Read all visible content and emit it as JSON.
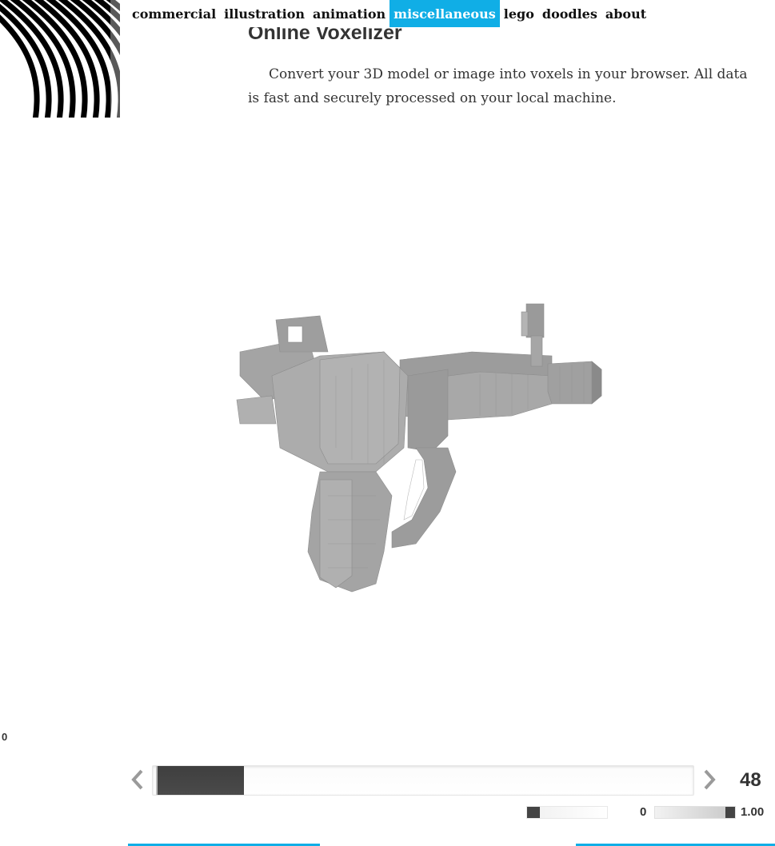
{
  "nav": {
    "items": [
      {
        "label": "commercial",
        "active": false
      },
      {
        "label": "illustration",
        "active": false
      },
      {
        "label": "animation",
        "active": false
      },
      {
        "label": "miscellaneous",
        "active": true
      },
      {
        "label": "lego",
        "active": false
      },
      {
        "label": "doodles",
        "active": false
      },
      {
        "label": "about",
        "active": false
      }
    ]
  },
  "page": {
    "title": "Online Voxelizer",
    "intro": "Convert your 3D model or image into voxels in your browser. All data is fast and securely processed on your local machine."
  },
  "viewport": {
    "left_readout": "0"
  },
  "resolution_slider": {
    "value": "48",
    "fill_fraction": 0.16
  },
  "mini_sliders": {
    "left_fraction": 0.0,
    "label": "0",
    "value": "1.00"
  },
  "colors": {
    "accent": "#10aee6",
    "text": "#333333",
    "slider_fill": "#444444",
    "voxel_light": "#aaaaaa",
    "voxel_dark": "#7a7a7a"
  },
  "icons": {
    "prev": "chevron-left-icon",
    "next": "chevron-right-icon"
  }
}
